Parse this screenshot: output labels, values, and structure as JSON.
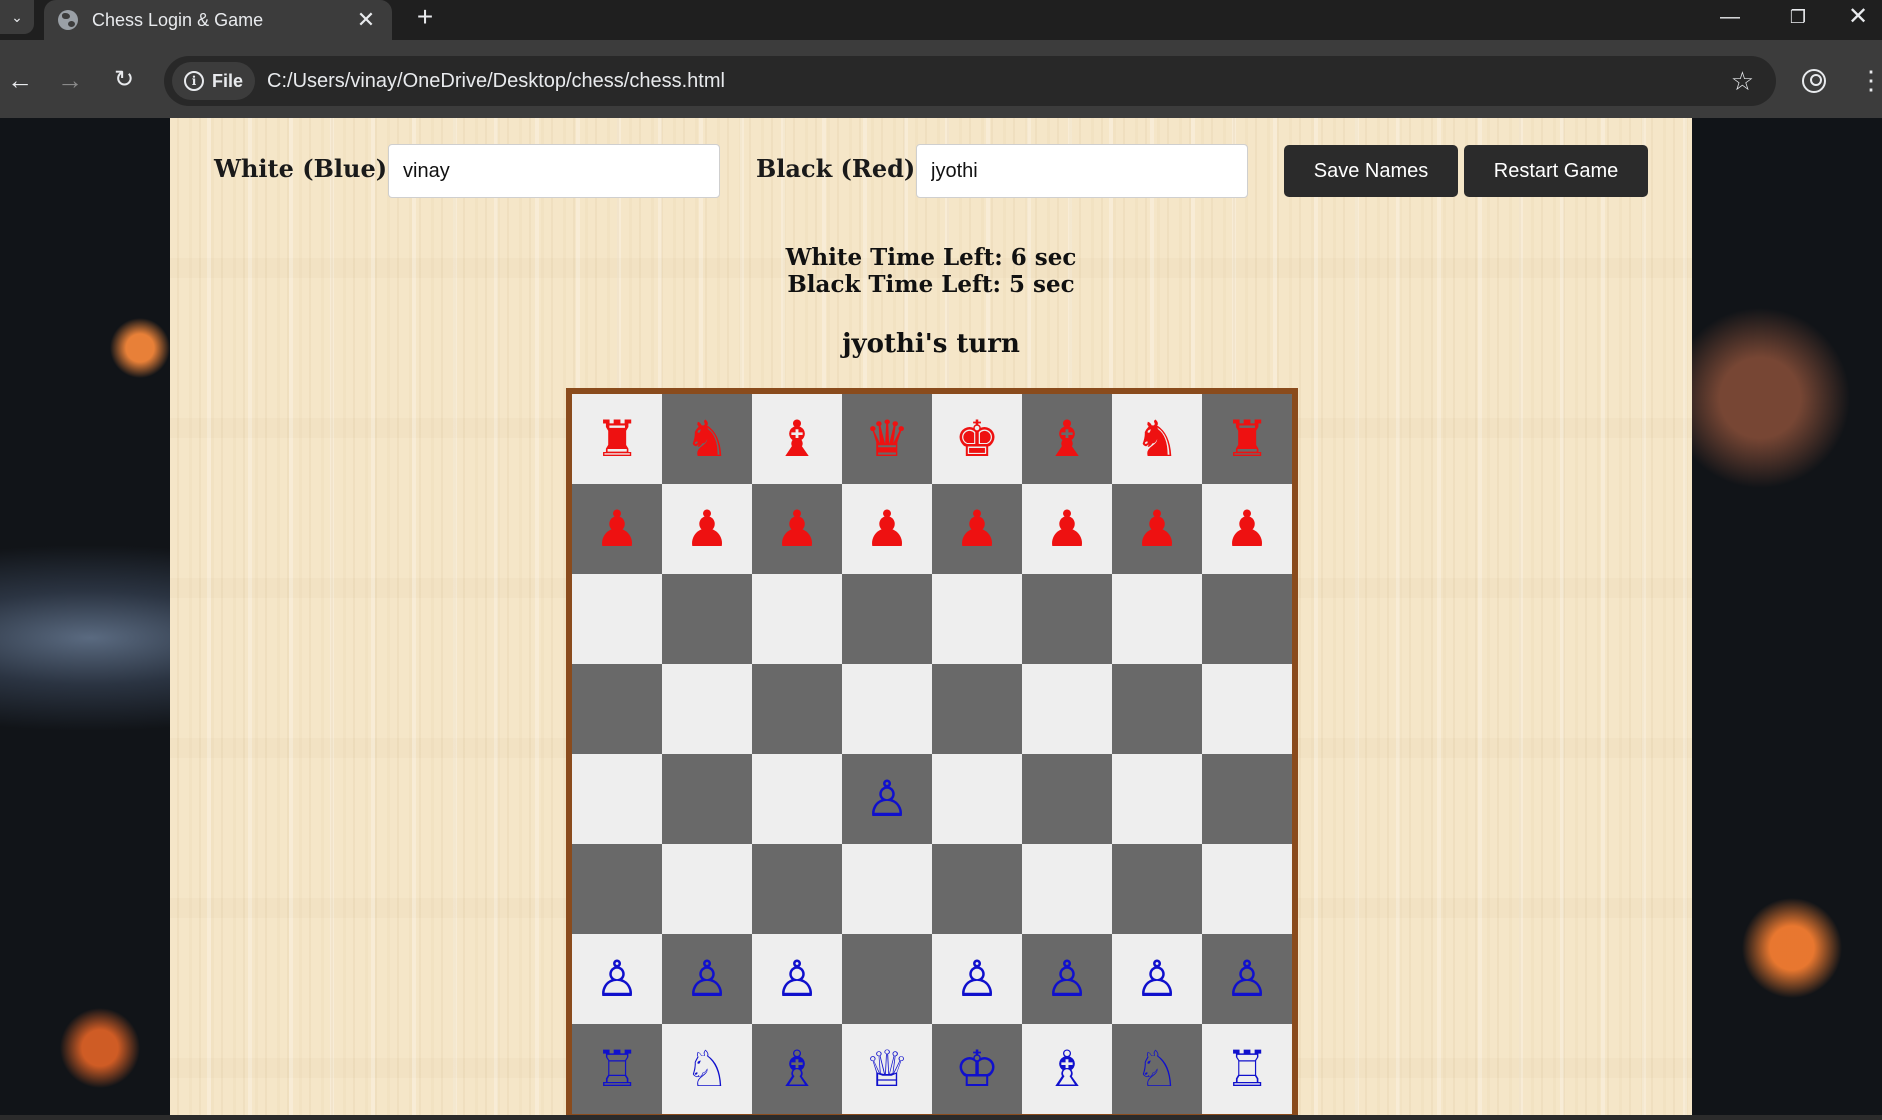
{
  "browser": {
    "tab_title": "Chess Login & Game",
    "tab_close": "✕",
    "new_tab": "+",
    "file_chip": "File",
    "url": "C:/Users/vinay/OneDrive/Desktop/chess/chess.html"
  },
  "form": {
    "white_label": "White (Blue):",
    "white_value": "vinay",
    "black_label": "Black (Red):",
    "black_value": "jyothi",
    "save_button": "Save Names",
    "restart_button": "Restart Game"
  },
  "status": {
    "white_time": "White Time Left: 6 sec",
    "black_time": "Black Time Left: 5 sec",
    "turn": "jyothi's turn"
  },
  "board": {
    "colors": {
      "light": "#eeeeee",
      "dark": "#696969",
      "border": "#8a4b1c",
      "red": "#ee1111",
      "blue": "#1010cc"
    },
    "rows": [
      [
        "♜",
        "♞",
        "♝",
        "♛",
        "♚",
        "♝",
        "♞",
        "♜"
      ],
      [
        "♟",
        "♟",
        "♟",
        "♟",
        "♟",
        "♟",
        "♟",
        "♟"
      ],
      [
        "",
        "",
        "",
        "",
        "",
        "",
        "",
        ""
      ],
      [
        "",
        "",
        "",
        "",
        "",
        "",
        "",
        ""
      ],
      [
        "",
        "",
        "",
        "♙",
        "",
        "",
        "",
        ""
      ],
      [
        "",
        "",
        "",
        "",
        "",
        "",
        "",
        ""
      ],
      [
        "♙",
        "♙",
        "♙",
        "",
        "♙",
        "♙",
        "♙",
        "♙"
      ],
      [
        "♖",
        "♘",
        "♗",
        "♕",
        "♔",
        "♗",
        "♘",
        "♖"
      ]
    ],
    "piece_sides": [
      [
        "red",
        "red",
        "red",
        "red",
        "red",
        "red",
        "red",
        "red"
      ],
      [
        "red",
        "red",
        "red",
        "red",
        "red",
        "red",
        "red",
        "red"
      ],
      [
        "",
        "",
        "",
        "",
        "",
        "",
        "",
        ""
      ],
      [
        "",
        "",
        "",
        "",
        "",
        "",
        "",
        ""
      ],
      [
        "",
        "",
        "",
        "blue",
        "",
        "",
        "",
        ""
      ],
      [
        "",
        "",
        "",
        "",
        "",
        "",
        "",
        ""
      ],
      [
        "blue",
        "blue",
        "blue",
        "",
        "blue",
        "blue",
        "blue",
        "blue"
      ],
      [
        "blue",
        "blue",
        "blue",
        "blue",
        "blue",
        "blue",
        "blue",
        "blue"
      ]
    ],
    "piece_names": [
      [
        "rook",
        "knight",
        "bishop",
        "queen",
        "king",
        "bishop",
        "knight",
        "rook"
      ],
      [
        "pawn",
        "pawn",
        "pawn",
        "pawn",
        "pawn",
        "pawn",
        "pawn",
        "pawn"
      ],
      [
        "",
        "",
        "",
        "",
        "",
        "",
        "",
        ""
      ],
      [
        "",
        "",
        "",
        "",
        "",
        "",
        "",
        ""
      ],
      [
        "",
        "",
        "",
        "pawn",
        "",
        "",
        "",
        ""
      ],
      [
        "",
        "",
        "",
        "",
        "",
        "",
        "",
        ""
      ],
      [
        "pawn",
        "pawn",
        "pawn",
        "",
        "pawn",
        "pawn",
        "pawn",
        "pawn"
      ],
      [
        "rook",
        "knight",
        "bishop",
        "queen",
        "king",
        "bishop",
        "knight",
        "rook"
      ]
    ]
  }
}
